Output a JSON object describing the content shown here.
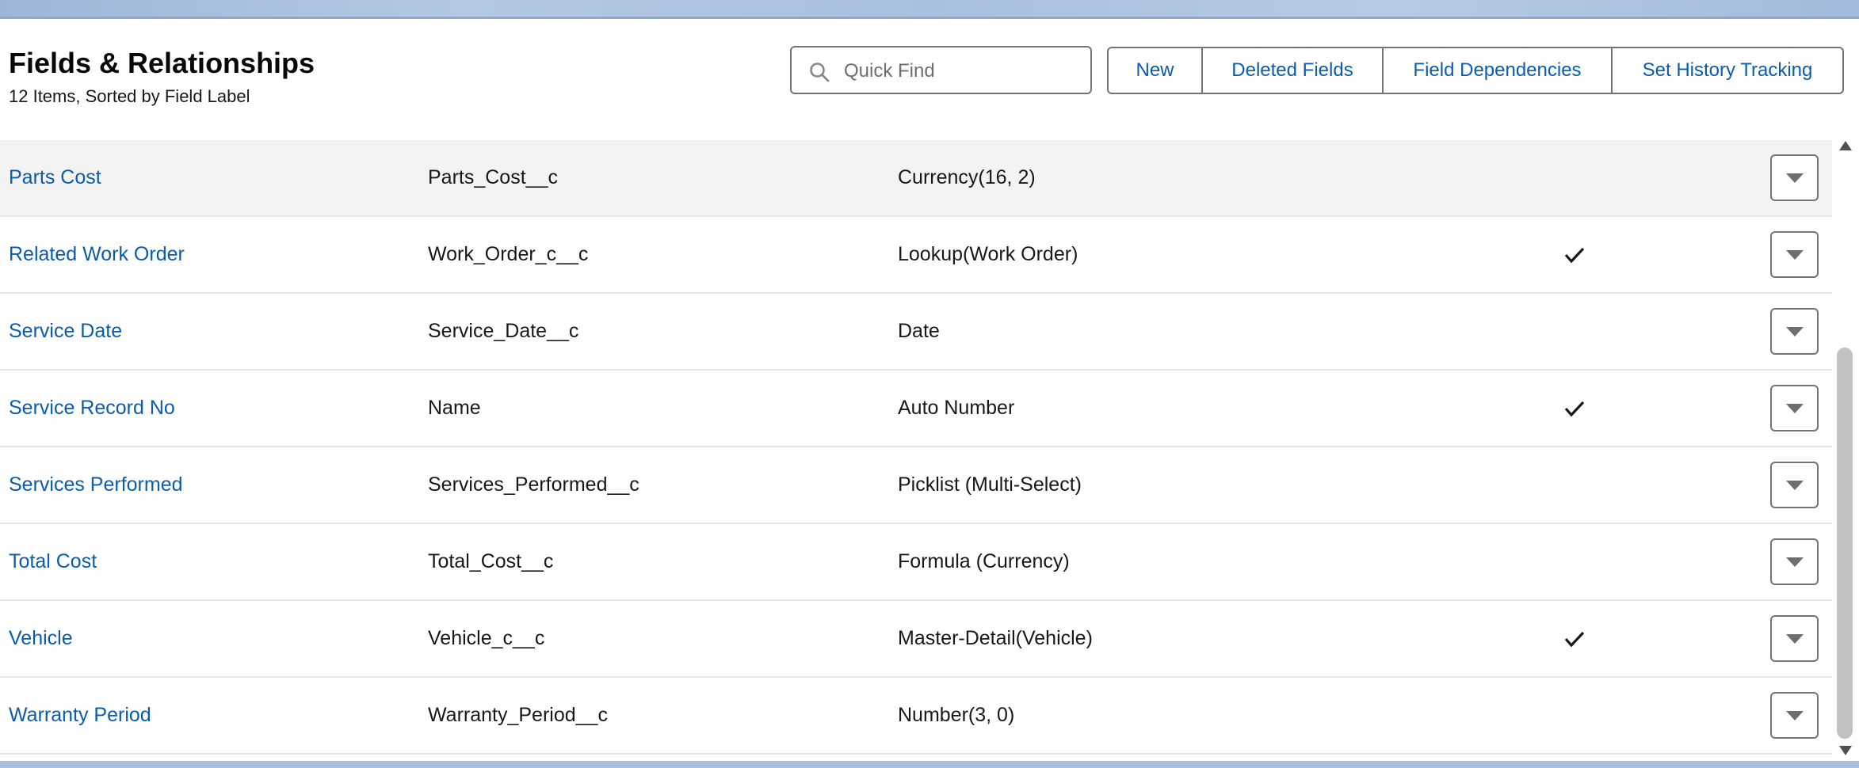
{
  "header": {
    "title": "Fields & Relationships",
    "subtitle": "12 Items, Sorted by Field Label"
  },
  "search": {
    "placeholder": "Quick Find"
  },
  "buttons": {
    "new": "New",
    "deleted_fields": "Deleted Fields",
    "field_dependencies": "Field Dependencies",
    "set_history_tracking": "Set History Tracking"
  },
  "rows": [
    {
      "label": "Parts Cost",
      "api_name": "Parts_Cost__c",
      "type": "Currency(16, 2)",
      "checked": false,
      "highlight": true
    },
    {
      "label": "Related Work Order",
      "api_name": "Work_Order_c__c",
      "type": "Lookup(Work Order)",
      "checked": true
    },
    {
      "label": "Service Date",
      "api_name": "Service_Date__c",
      "type": "Date",
      "checked": false
    },
    {
      "label": "Service Record No",
      "api_name": "Name",
      "type": "Auto Number",
      "checked": true
    },
    {
      "label": "Services Performed",
      "api_name": "Services_Performed__c",
      "type": "Picklist (Multi-Select)",
      "checked": false
    },
    {
      "label": "Total Cost",
      "api_name": "Total_Cost__c",
      "type": "Formula (Currency)",
      "checked": false
    },
    {
      "label": "Vehicle",
      "api_name": "Vehicle_c__c",
      "type": "Master-Detail(Vehicle)",
      "checked": true
    },
    {
      "label": "Warranty Period",
      "api_name": "Warranty_Period__c",
      "type": "Number(3, 0)",
      "checked": false
    }
  ],
  "colors": {
    "link": "#0b5cab",
    "border": "#747474",
    "row_highlight": "#f3f3f3"
  },
  "icons": {
    "search": "search-icon",
    "check": "checkmark-icon",
    "row_action": "chevron-down-icon"
  }
}
